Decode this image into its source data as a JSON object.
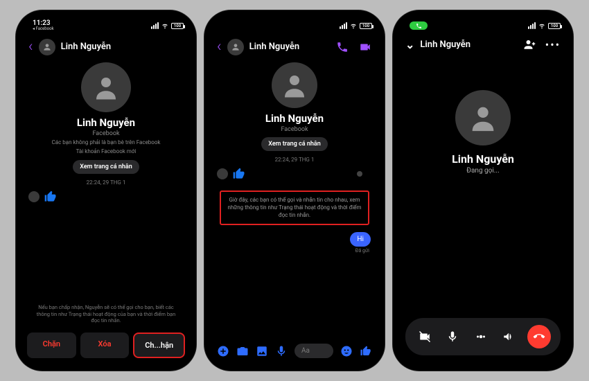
{
  "status": {
    "time": "11:23",
    "sub": "◂ Facebook",
    "battery": "100"
  },
  "common": {
    "name": "Linh Nguyễn",
    "platform": "Facebook",
    "view_profile": "Xem trang cá nhân",
    "timestamp": "22:24, 29 THG 1"
  },
  "phone1": {
    "note1": "Các bạn không phải là bạn bè trên Facebook",
    "note2": "Tài khoản Facebook mới",
    "bottom_note": "Nếu bạn chấp nhận, Nguyễn sẽ có thể gọi cho bạn, biết các thông tin như Trạng thái hoạt động của bạn và thời điểm bạn đọc tin nhắn.",
    "block": "Chặn",
    "delete": "Xóa",
    "accept": "Ch...hận"
  },
  "phone2": {
    "notice": "Giờ đây, các bạn có thể gọi và nhắn tin cho nhau, xem những thông tin như Trạng thái hoạt động và thời điểm đọc tin nhắn.",
    "msg": "Hi",
    "sent": "Đã gửi",
    "placeholder": "Aa"
  },
  "phone3": {
    "status": "Đang gọi..."
  }
}
